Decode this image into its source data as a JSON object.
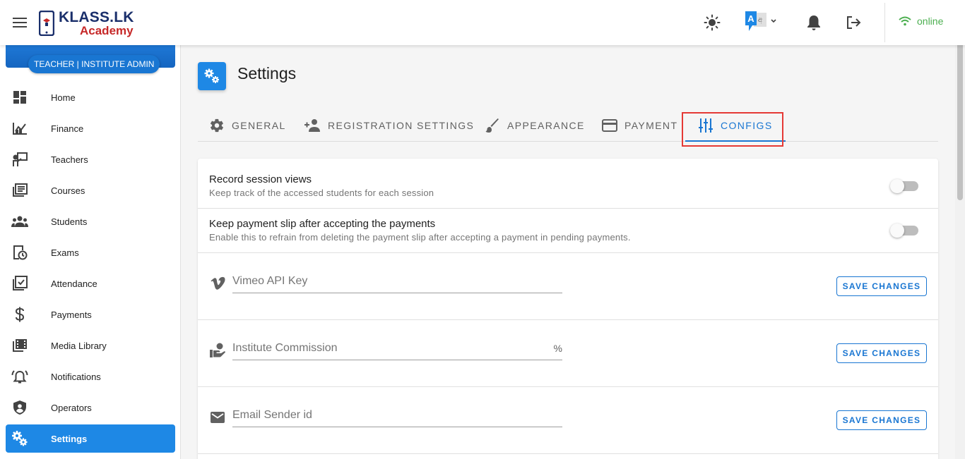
{
  "header": {
    "logo_main": "KLASS.LK",
    "logo_sub": "Academy",
    "status": "online",
    "icons": [
      "menu-icon",
      "brightness-icon",
      "translate-icon",
      "bell-icon",
      "logout-icon",
      "wifi-icon"
    ]
  },
  "sidebar": {
    "role": "TEACHER | INSTITUTE ADMIN",
    "items": [
      {
        "label": "Home",
        "icon": "dashboard-icon"
      },
      {
        "label": "Finance",
        "icon": "chart-icon"
      },
      {
        "label": "Teachers",
        "icon": "teacher-icon"
      },
      {
        "label": "Courses",
        "icon": "library-icon"
      },
      {
        "label": "Students",
        "icon": "people-icon"
      },
      {
        "label": "Exams",
        "icon": "exam-icon"
      },
      {
        "label": "Attendance",
        "icon": "checklist-icon"
      },
      {
        "label": "Payments",
        "icon": "dollar-icon"
      },
      {
        "label": "Media Library",
        "icon": "film-icon"
      },
      {
        "label": "Notifications",
        "icon": "alarm-icon"
      },
      {
        "label": "Operators",
        "icon": "shield-icon"
      },
      {
        "label": "Settings",
        "icon": "cogs-icon",
        "active": true
      }
    ]
  },
  "page": {
    "title": "Settings",
    "tabs": [
      {
        "label": "GENERAL",
        "icon": "gear-icon"
      },
      {
        "label": "REGISTRATION SETTINGS",
        "icon": "add-person-icon"
      },
      {
        "label": "APPEARANCE",
        "icon": "brush-icon"
      },
      {
        "label": "PAYMENT",
        "icon": "credit-card-icon"
      },
      {
        "label": "CONFIGS",
        "icon": "tune-icon",
        "active": true
      }
    ],
    "toggles": [
      {
        "title": "Record session views",
        "subtitle": "Keep track of the accessed students for each session",
        "on": false
      },
      {
        "title": "Keep payment slip after accepting the payments",
        "subtitle": "Enable this to refrain from deleting the payment slip after accepting a payment in pending payments.",
        "on": false
      }
    ],
    "fields": [
      {
        "placeholder": "Vimeo API Key",
        "suffix": "",
        "button": "SAVE CHANGES",
        "icon": "vimeo-icon"
      },
      {
        "placeholder": "Institute Commission",
        "suffix": "%",
        "button": "SAVE CHANGES",
        "icon": "hand-money-icon"
      },
      {
        "placeholder": "Email Sender id",
        "suffix": "",
        "button": "SAVE CHANGES",
        "icon": "email-icon"
      }
    ]
  },
  "colors": {
    "primary": "#1976d2",
    "highlight": "#e53935",
    "online": "#4caf50"
  }
}
